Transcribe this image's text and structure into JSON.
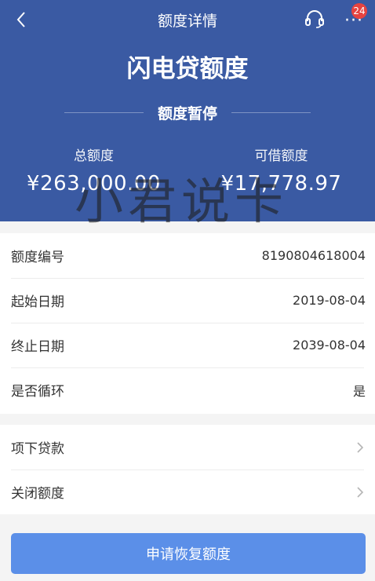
{
  "nav": {
    "title": "额度详情",
    "badge_count": "24"
  },
  "header": {
    "product_title": "闪电贷额度",
    "status": "额度暂停",
    "total_label": "总额度",
    "total_value": "¥263,000.00",
    "available_label": "可借额度",
    "available_value": "¥17,778.97",
    "bg_color": "#3a5aa3"
  },
  "watermark": "小君说卡",
  "details": [
    {
      "label": "额度编号",
      "value": "8190804618004"
    },
    {
      "label": "起始日期",
      "value": "2019-08-04"
    },
    {
      "label": "终止日期",
      "value": "2039-08-04"
    },
    {
      "label": "是否循环",
      "value": "是"
    }
  ],
  "links": [
    {
      "label": "项下贷款"
    },
    {
      "label": "关闭额度"
    }
  ],
  "action": {
    "label": "申请恢复额度",
    "color": "#5b8fe8"
  }
}
